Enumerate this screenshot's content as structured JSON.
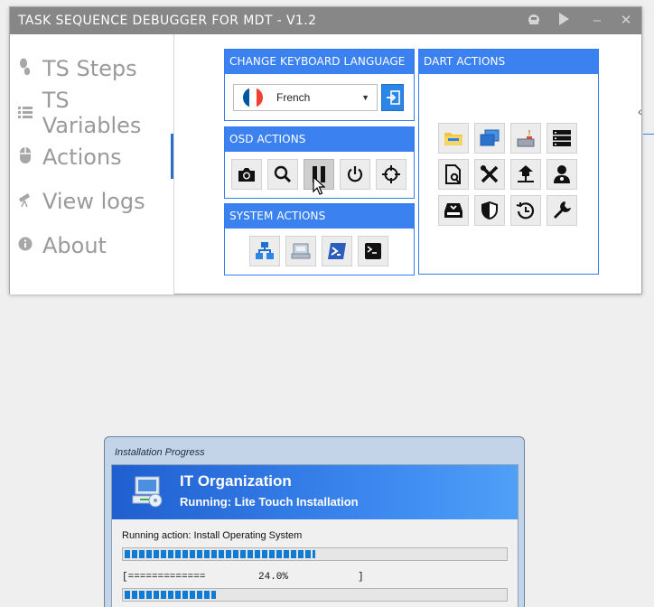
{
  "window": {
    "title": "TASK SEQUENCE DEBUGGER FOR MDT - V1.2",
    "controls": [
      "helmet-icon",
      "play-icon",
      "minimize-icon",
      "close-icon"
    ],
    "minimize_glyph": "‒",
    "close_glyph": "✕"
  },
  "sidebar": {
    "items": [
      {
        "label": "TS Steps",
        "icon": "footsteps-icon"
      },
      {
        "label": "TS Variables",
        "icon": "list-icon"
      },
      {
        "label": "Actions",
        "icon": "mouse-icon",
        "active": true
      },
      {
        "label": "View logs",
        "icon": "telescope-icon"
      },
      {
        "label": "About",
        "icon": "info-icon"
      }
    ]
  },
  "keyboard_panel": {
    "title": "CHANGE KEYBOARD LANGUAGE",
    "selected_language": "French",
    "flag_colors": [
      "#0055a4",
      "#ffffff",
      "#ef4135"
    ],
    "apply_icon": "sign-in-icon"
  },
  "osd_panel": {
    "title": "OSD ACTIONS",
    "buttons": [
      "camera-icon",
      "search-icon",
      "pause-icon",
      "power-icon",
      "crosshair-icon"
    ],
    "active_button": "pause-icon"
  },
  "system_panel": {
    "title": "SYSTEM ACTIONS",
    "buttons": [
      "network-icon",
      "devices-icon",
      "powershell-icon",
      "terminal-icon"
    ]
  },
  "dart_panel": {
    "title": "DART ACTIONS",
    "buttons": [
      "explorer-folder-icon",
      "window-icon",
      "disk-cleanup-icon",
      "server-icon",
      "file-search-icon",
      "tools-icon",
      "network-share-icon",
      "doctor-icon",
      "disk-icon",
      "shield-icon",
      "restore-icon",
      "wrench-icon"
    ]
  },
  "edge_glyph": "‹",
  "install": {
    "window_title": "Installation Progress",
    "organization": "IT Organization",
    "running": "Running: Lite Touch Installation",
    "action": "Running action: Install Operating System",
    "action_progress": 0.5,
    "overall_ascii_left": "[=============",
    "overall_percent": "24.0%",
    "overall_ascii_right": "]",
    "overall_progress": 0.24
  },
  "colors": {
    "accent": "#3b82f0",
    "titlebar": "#878787",
    "progress": "#0f7bd4"
  }
}
